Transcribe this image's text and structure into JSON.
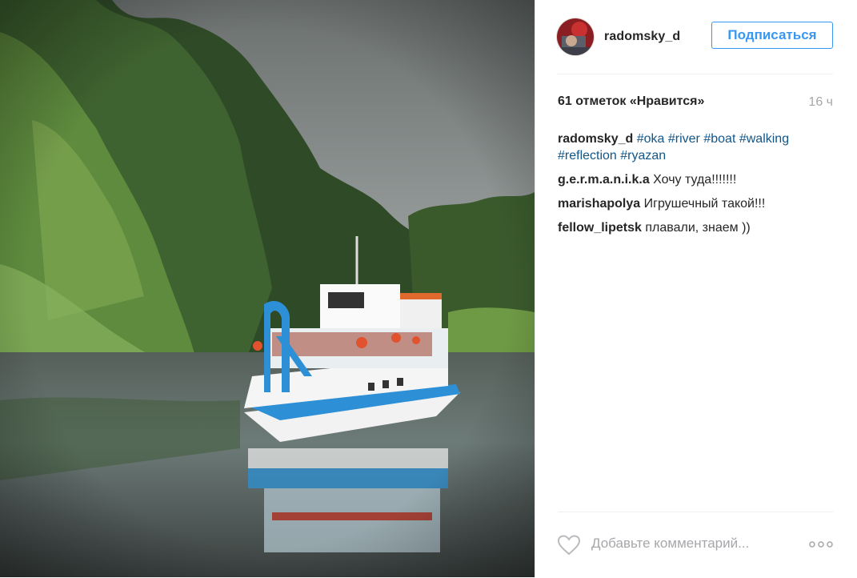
{
  "post": {
    "username": "radomsky_d",
    "follow_label": "Подписаться",
    "likes_text": "61 отметок «Нравится»",
    "time_ago": "16 ч"
  },
  "caption": {
    "user": "radomsky_d",
    "tags": [
      "#oka",
      "#river",
      "#boat",
      "#walking",
      "#reflection",
      "#ryazan"
    ]
  },
  "comments": [
    {
      "user": "g.e.r.m.a.n.i.k.a",
      "text": "Хочу туда!!!!!!!"
    },
    {
      "user": "marishapolya",
      "text": "Игрушечный такой!!!"
    },
    {
      "user": "fellow_lipetsk",
      "text": "плавали, знаем ))"
    }
  ],
  "footer": {
    "comment_placeholder": "Добавьте комментарий...",
    "like_icon": "heart-icon",
    "more_icon": "more-options-icon"
  },
  "colors": {
    "accent": "#3897f0",
    "hashtag": "#125688",
    "muted": "#a5a7aa",
    "text": "#262626"
  }
}
